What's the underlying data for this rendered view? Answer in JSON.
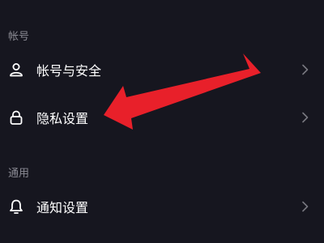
{
  "sections": {
    "account": {
      "header": "帐号",
      "items": [
        {
          "label": "帐号与安全",
          "icon": "person-icon"
        },
        {
          "label": "隐私设置",
          "icon": "lock-icon"
        }
      ]
    },
    "general": {
      "header": "通用",
      "items": [
        {
          "label": "通知设置",
          "icon": "bell-icon"
        }
      ]
    }
  },
  "colors": {
    "background": "#16161f",
    "text": "#ffffff",
    "secondary_text": "#8a8a93",
    "annotation_arrow": "#e8202a"
  }
}
